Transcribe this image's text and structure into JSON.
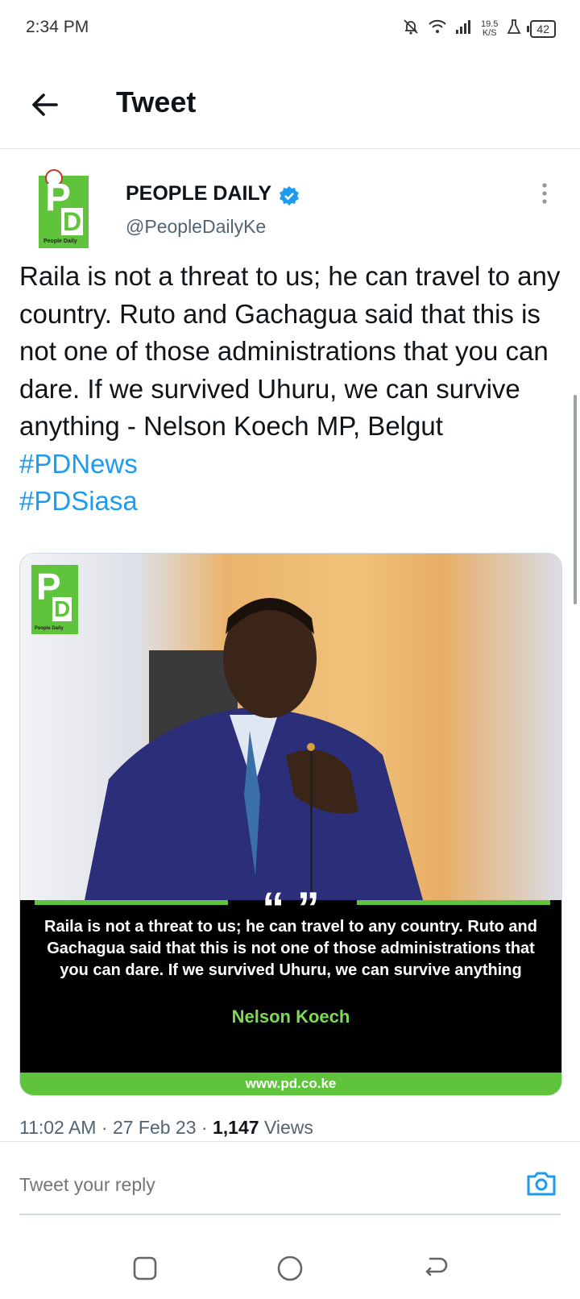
{
  "status_bar": {
    "time": "2:34 PM",
    "network_speed_value": "19.5",
    "network_speed_unit": "K/S",
    "battery": "42",
    "icons": [
      "mute-icon",
      "wifi-icon",
      "signal-icon",
      "flask-icon",
      "battery-icon"
    ]
  },
  "header": {
    "title": "Tweet",
    "back_icon": "arrow-left-icon"
  },
  "tweet": {
    "author_name": "PEOPLE DAILY",
    "author_handle": "@PeopleDailyKe",
    "verified": true,
    "avatar_letter_p": "P",
    "avatar_letter_d": "D",
    "avatar_caption": "People Daily",
    "text": "Raila is not a threat to us; he can travel to any country. Ruto and Gachagua said that this is not one of those administrations that you can dare. If we survived Uhuru, we can survive anything - Nelson Koech MP, Belgut ",
    "hashtag_1": "#PDNews",
    "hashtag_2": "#PDSiasa",
    "media": {
      "logo_p": "P",
      "logo_d": "D",
      "logo_caption": "People Daily",
      "quote_marks": "“ ”",
      "quote": "Raila is not a threat to us; he can travel to any country. Ruto and Gachagua said that this is not one of those administrations that you can dare. If we survived Uhuru, we can survive anything",
      "quote_author": "Nelson Koech",
      "site": "www.pd.co.ke"
    },
    "time": "11:02 AM",
    "separator": "·",
    "date": "27 Feb 23",
    "views_count": "1,147",
    "views_label": "Views"
  },
  "reply": {
    "placeholder": "Tweet your reply",
    "camera_icon": "camera-icon"
  },
  "colors": {
    "accent": "#1d9bf0",
    "brand_green": "#60c33c",
    "quote_author_green": "#7ed957",
    "muted": "#536471"
  }
}
